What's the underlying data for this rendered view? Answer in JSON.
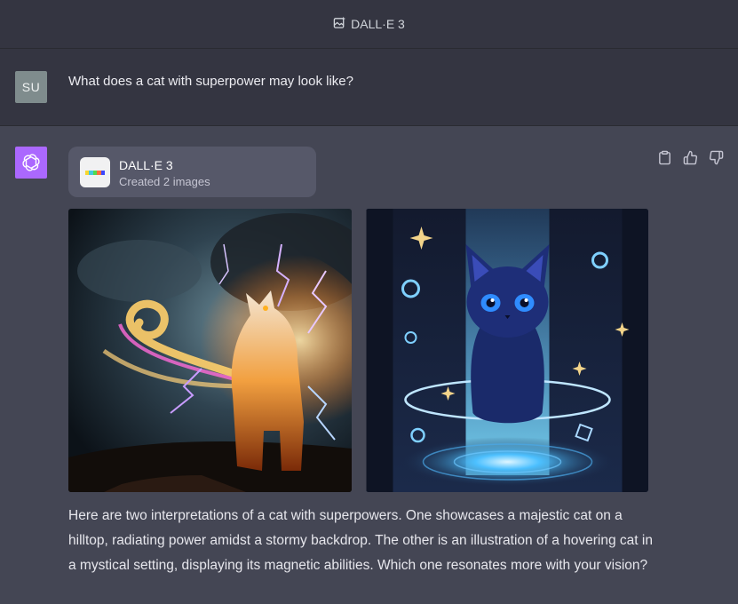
{
  "header": {
    "title": "DALL·E 3",
    "icon": "image-sparkle-icon"
  },
  "user_message": {
    "avatar_initials": "SU",
    "text": "What does a cat with superpower may look like?"
  },
  "assistant": {
    "avatar_icon": "openai-logo-icon",
    "tool": {
      "name": "DALL·E 3",
      "status": "Created 2 images",
      "icon_colors": [
        "#f9d72f",
        "#43c9dd",
        "#51da4c",
        "#ff6e3c",
        "#3c46ff"
      ]
    },
    "actions": [
      "copy-icon",
      "thumbs-up-icon",
      "thumbs-down-icon"
    ],
    "images": [
      {
        "name": "lightning-cat-image"
      },
      {
        "name": "mystical-cat-image"
      }
    ],
    "response": "Here are two interpretations of a cat with superpowers. One showcases a majestic cat on a hilltop, radiating power amidst a stormy backdrop. The other is an illustration of a hovering cat in a mystical setting, displaying its magnetic abilities. Which one resonates more with your vision?"
  },
  "colors": {
    "page_bg": "#444654",
    "user_row_bg": "#343541",
    "gpt_avatar": "#ab68ff",
    "user_avatar": "#7f8c8d",
    "tool_card_bg": "#565869"
  }
}
